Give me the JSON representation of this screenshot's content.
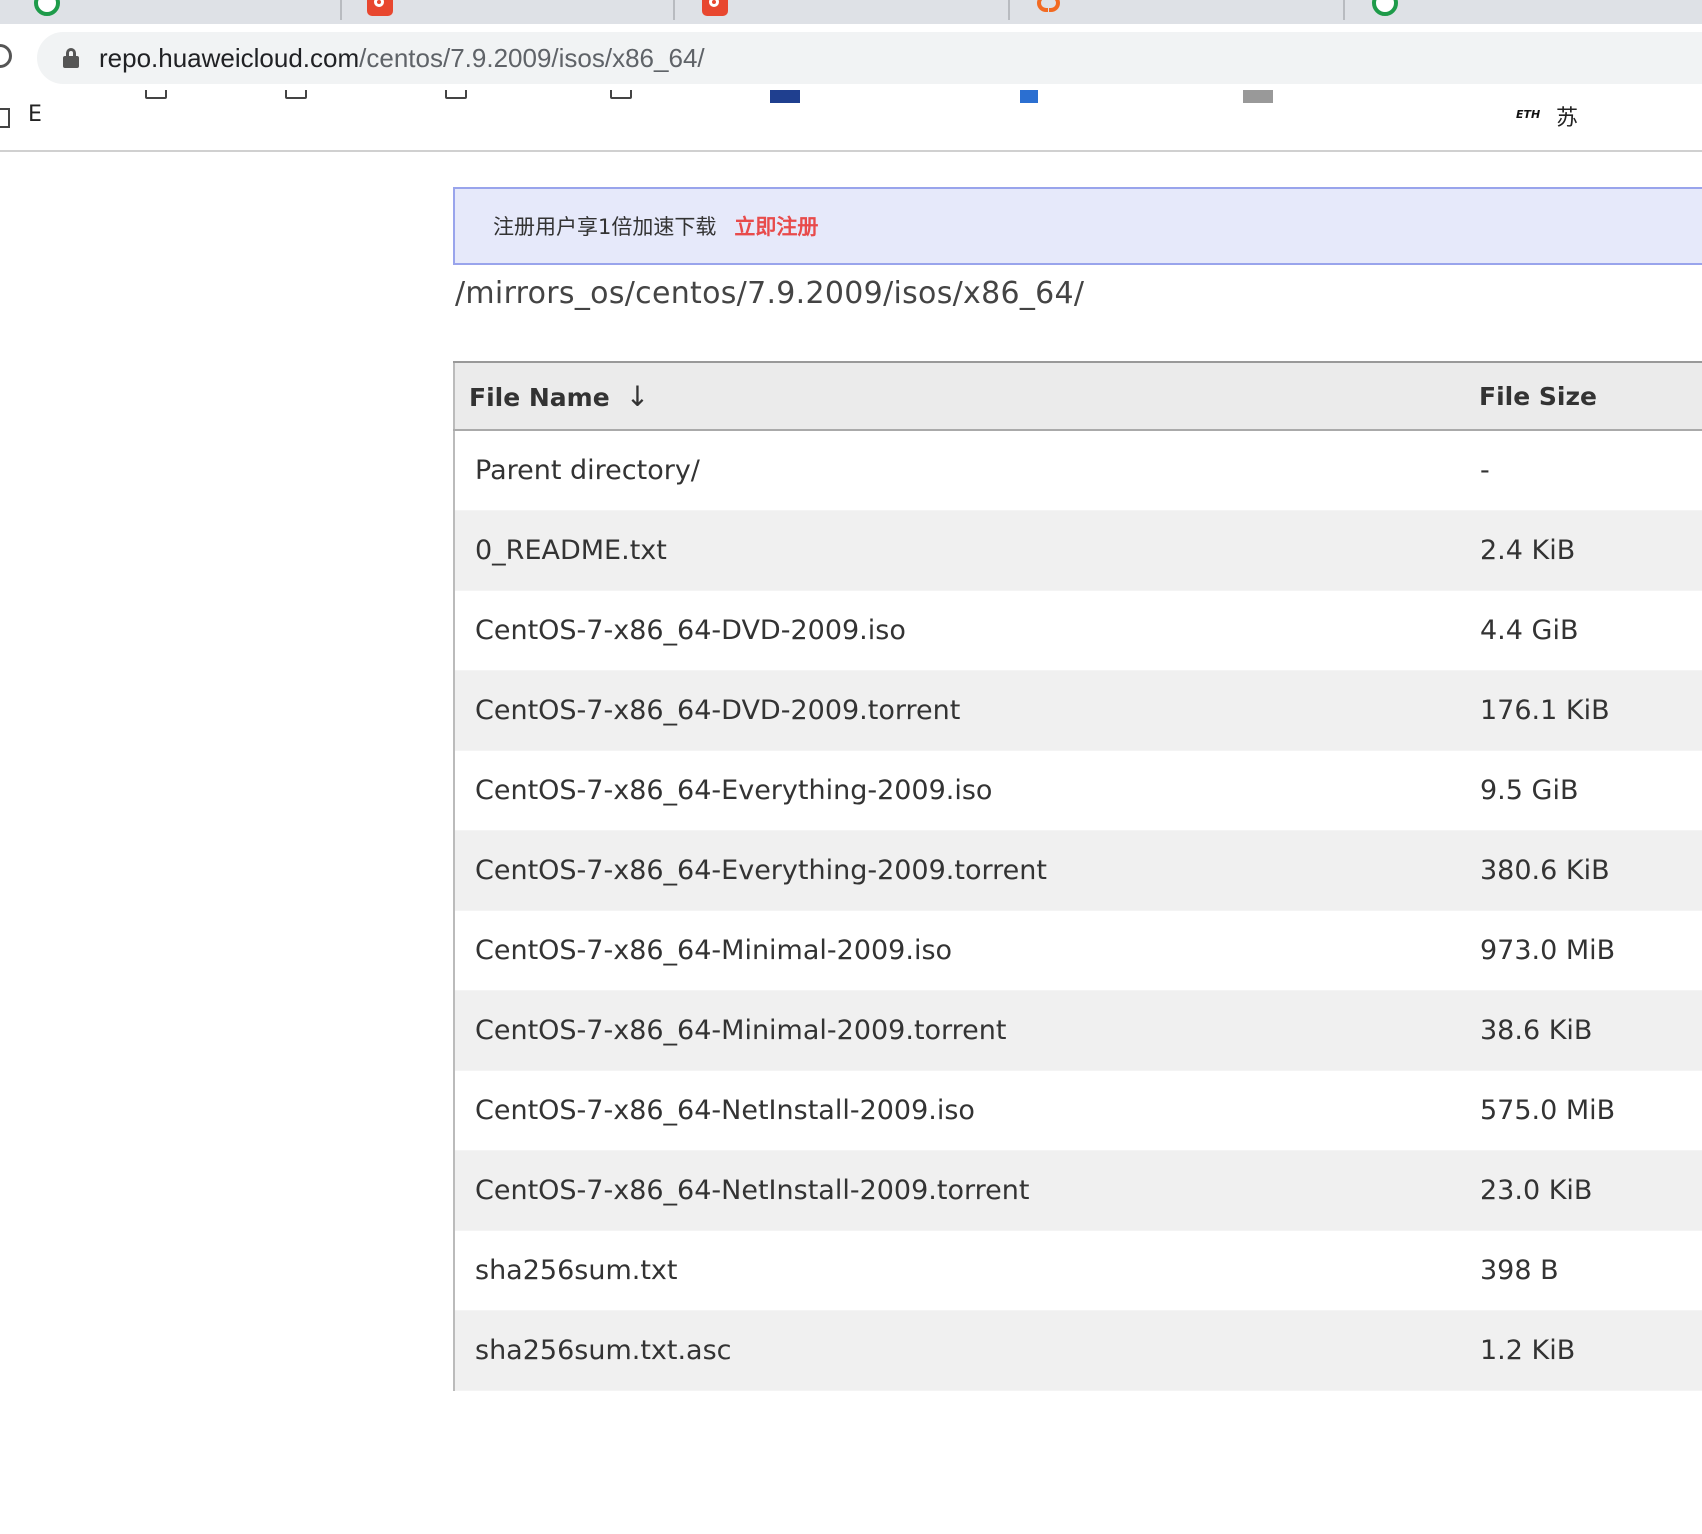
{
  "browser": {
    "tabs": [
      {
        "favicon": "green-circle-icon",
        "title": ""
      },
      {
        "favicon": "red-c-icon",
        "title": ""
      },
      {
        "favicon": "red-c-icon",
        "title": ""
      },
      {
        "favicon": "orange-alibaba-icon",
        "title": ""
      },
      {
        "favicon": "green-circle-icon",
        "title": ""
      }
    ],
    "url_host": "repo.huaweicloud.com",
    "url_path": "/centos/7.9.2009/isos/x86_64/",
    "bookmarks": {
      "first_letter": "E",
      "eth_label": "ETH",
      "tail_char": "苏"
    }
  },
  "banner": {
    "text": "注册用户享1倍加速下载",
    "link": "立即注册",
    "link_color": "#e84b4b"
  },
  "directory_path": "/mirrors_os/centos/7.9.2009/isos/x86_64/",
  "table": {
    "columns": [
      "File Name",
      "File Size"
    ],
    "sort_indicator": "↓",
    "rows": [
      {
        "name": "Parent directory/",
        "size": "-"
      },
      {
        "name": "0_README.txt",
        "size": "2.4 KiB"
      },
      {
        "name": "CentOS-7-x86_64-DVD-2009.iso",
        "size": "4.4 GiB"
      },
      {
        "name": "CentOS-7-x86_64-DVD-2009.torrent",
        "size": "176.1 KiB"
      },
      {
        "name": "CentOS-7-x86_64-Everything-2009.iso",
        "size": "9.5 GiB"
      },
      {
        "name": "CentOS-7-x86_64-Everything-2009.torrent",
        "size": "380.6 KiB"
      },
      {
        "name": "CentOS-7-x86_64-Minimal-2009.iso",
        "size": "973.0 MiB"
      },
      {
        "name": "CentOS-7-x86_64-Minimal-2009.torrent",
        "size": "38.6 KiB"
      },
      {
        "name": "CentOS-7-x86_64-NetInstall-2009.iso",
        "size": "575.0 MiB"
      },
      {
        "name": "CentOS-7-x86_64-NetInstall-2009.torrent",
        "size": "23.0 KiB"
      },
      {
        "name": "sha256sum.txt",
        "size": "398 B"
      },
      {
        "name": "sha256sum.txt.asc",
        "size": "1.2 KiB"
      }
    ]
  }
}
